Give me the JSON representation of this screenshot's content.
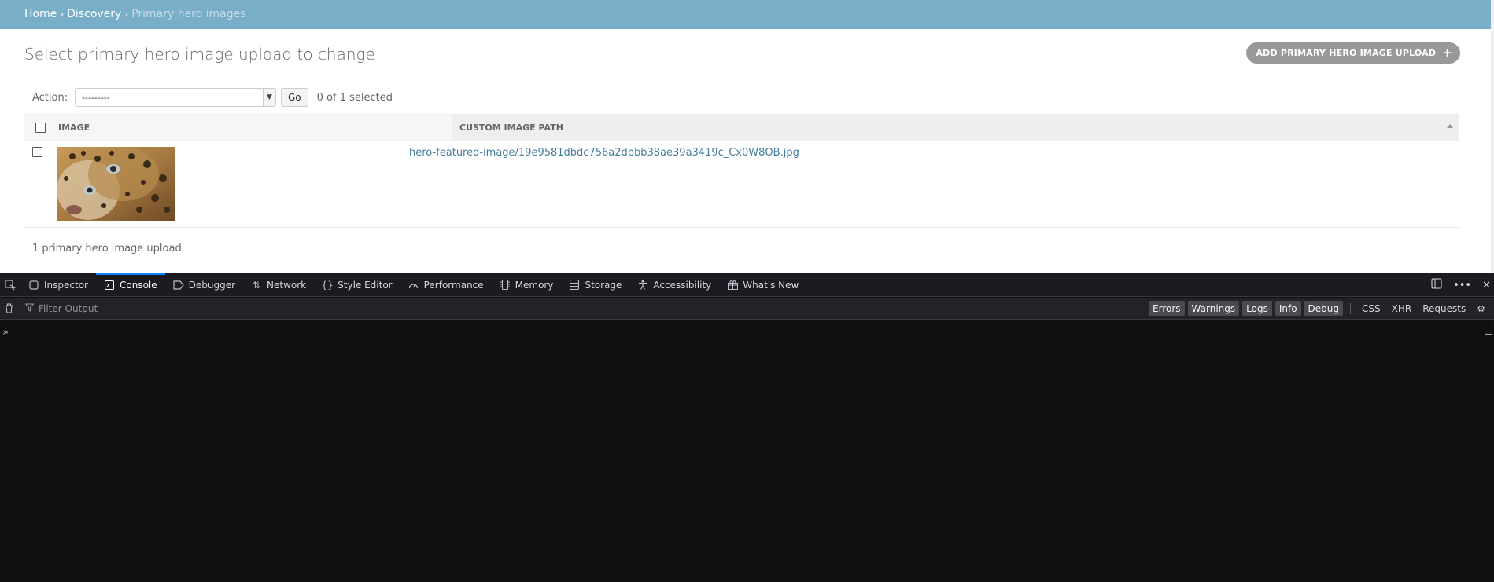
{
  "breadcrumbs": {
    "home": "Home",
    "sep1": "›",
    "discovery": "Discovery",
    "sep2": "›",
    "current": "Primary hero images"
  },
  "page": {
    "title": "Select primary hero image upload to change",
    "add_button": "ADD PRIMARY HERO IMAGE UPLOAD",
    "add_icon": "+"
  },
  "actions": {
    "label": "Action:",
    "selected_value": "---------",
    "go_label": "Go",
    "counter": "0 of 1 selected"
  },
  "table": {
    "columns": [
      "IMAGE",
      "CUSTOM IMAGE PATH"
    ],
    "rows": [
      {
        "image_alt": "leopard-thumbnail",
        "path": "hero-featured-image/19e9581dbdc756a2dbbb38ae39a3419c_Cx0W8OB.jpg"
      }
    ]
  },
  "paginator": "1 primary hero image upload",
  "devtools": {
    "tabs": [
      {
        "label": "Inspector",
        "icon": "inspector-icon"
      },
      {
        "label": "Console",
        "icon": "console-icon",
        "active": true
      },
      {
        "label": "Debugger",
        "icon": "debugger-icon"
      },
      {
        "label": "Network",
        "icon": "network-icon"
      },
      {
        "label": "Style Editor",
        "icon": "style-editor-icon"
      },
      {
        "label": "Performance",
        "icon": "performance-icon"
      },
      {
        "label": "Memory",
        "icon": "memory-icon"
      },
      {
        "label": "Storage",
        "icon": "storage-icon"
      },
      {
        "label": "Accessibility",
        "icon": "accessibility-icon"
      },
      {
        "label": "What's New",
        "icon": "whats-new-icon"
      }
    ],
    "filter_placeholder": "Filter Output",
    "toggles": [
      "Errors",
      "Warnings",
      "Logs",
      "Info",
      "Debug"
    ],
    "plain_toggles": [
      "CSS",
      "XHR",
      "Requests"
    ],
    "prompt": "»"
  },
  "colors": {
    "breadcrumb_bg": "#79aec8",
    "link": "#447e9b",
    "devtools_bg": "#0f0f10",
    "active_tab_accent": "#0a84ff"
  }
}
